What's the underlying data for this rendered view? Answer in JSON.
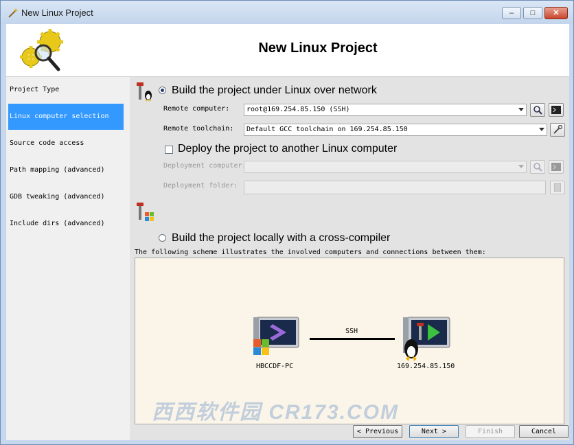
{
  "window": {
    "title": "New Linux Project",
    "controls": {
      "minimize": "–",
      "maximize": "□",
      "close": "✕"
    }
  },
  "header": {
    "title": "New Linux Project"
  },
  "nav": {
    "items": [
      {
        "label": "Project Type",
        "active": false
      },
      {
        "label": "Linux computer selection",
        "active": true
      },
      {
        "label": "Source code access",
        "active": false
      },
      {
        "label": "Path mapping (advanced)",
        "active": false
      },
      {
        "label": "GDB tweaking (advanced)",
        "active": false
      },
      {
        "label": "Include dirs (advanced)",
        "active": false
      }
    ]
  },
  "options": {
    "network": {
      "label": "Build the project under Linux over network",
      "selected": true,
      "remote_computer_label": "Remote computer:",
      "remote_computer_value": "root@169.254.85.150 (SSH)",
      "remote_toolchain_label": "Remote toolchain:",
      "remote_toolchain_value": "Default GCC toolchain on 169.254.85.150"
    },
    "deploy": {
      "label": "Deploy the project to another Linux computer",
      "checked": false,
      "deployment_computer_label": "Deployment computer:",
      "deployment_folder_label": "Deployment folder:"
    },
    "local": {
      "label": "Build the project locally with a cross-compiler",
      "selected": false
    }
  },
  "scheme": {
    "description": "The following scheme illustrates the involved computers and connections between them:",
    "local_computer": "HBCCDF-PC",
    "remote_computer": "169.254.85.150",
    "connection": "SSH"
  },
  "buttons": {
    "previous": "Previous",
    "next": "Next",
    "finish": "Finish",
    "cancel": "Cancel"
  },
  "watermark": "西西软件园 CR173.COM",
  "colors": {
    "selection": "#3399ff",
    "scheme_background": "#faf5e8"
  }
}
